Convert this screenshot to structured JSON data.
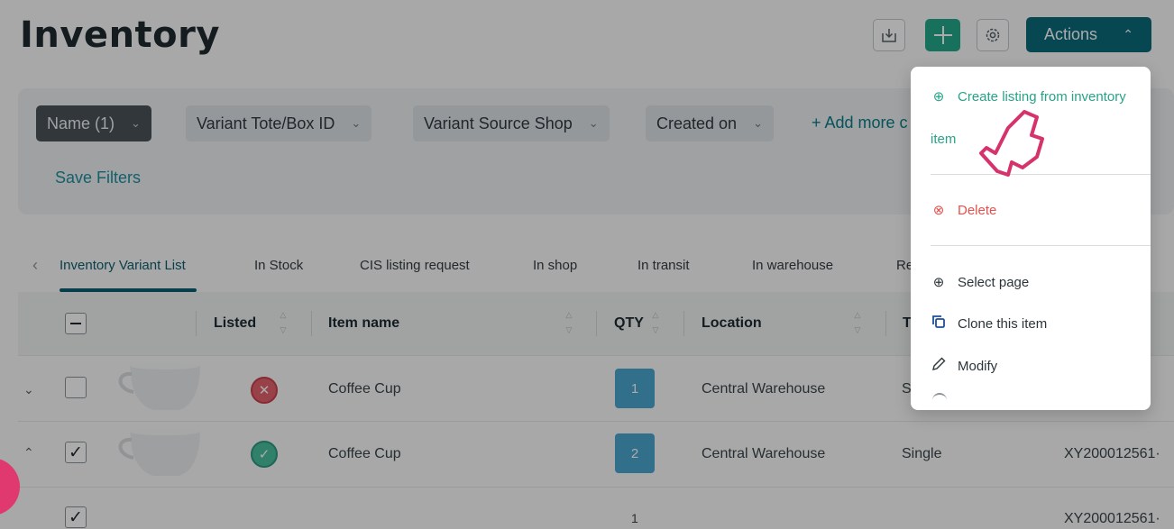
{
  "header": {
    "title": "Inventory",
    "actions_label": "Actions",
    "actions_chevron": "^"
  },
  "filters": {
    "chips": [
      {
        "label": "Name (1)",
        "active": true
      },
      {
        "label": "Variant Tote/Box ID",
        "active": false
      },
      {
        "label": "Variant Source Shop",
        "active": false
      },
      {
        "label": "Created on",
        "active": false
      }
    ],
    "add_more": "+ Add more c",
    "save_filters": "Save Filters"
  },
  "tabs": [
    {
      "label": "Inventory Variant List",
      "active": true
    },
    {
      "label": "In Stock"
    },
    {
      "label": "CIS listing request"
    },
    {
      "label": "In shop"
    },
    {
      "label": "In transit"
    },
    {
      "label": "In warehouse"
    },
    {
      "label": "Re"
    }
  ],
  "table": {
    "headers": {
      "listed": "Listed",
      "item_name": "Item name",
      "qty": "QTY",
      "location": "Location",
      "type": "T"
    },
    "rows": [
      {
        "expanded": false,
        "checked": false,
        "listed": false,
        "item_name": "Coffee Cup",
        "qty": "1",
        "location": "Central Warehouse",
        "type": "S",
        "id": ""
      },
      {
        "expanded": true,
        "checked": true,
        "listed": true,
        "item_name": "Coffee Cup",
        "qty": "2",
        "location": "Central Warehouse",
        "type": "Single",
        "id": "XY200012561·"
      },
      {
        "checked": true,
        "qty": "1",
        "id": "XY200012561·"
      }
    ]
  },
  "dropdown": {
    "create_line1": "Create listing from inventory",
    "create_line2": "item",
    "delete": "Delete",
    "select_page": "Select page",
    "clone": "Clone this item",
    "modify": "Modify"
  },
  "colors": {
    "accent": "#0a6a7a",
    "add_button": "#23a98b",
    "listed_yes": "#48bf9f",
    "listed_no": "#e4626c",
    "delete": "#e2524f",
    "pointer": "#d6336c"
  },
  "icons": {
    "import": "import-icon",
    "add": "plus-icon",
    "settings": "gear-icon",
    "create": "plus-circle-icon",
    "delete": "x-circle-icon",
    "select_page": "plus-circle-icon",
    "clone": "copy-icon",
    "modify": "pencil-icon",
    "pointer": "hand-pointer-icon"
  }
}
